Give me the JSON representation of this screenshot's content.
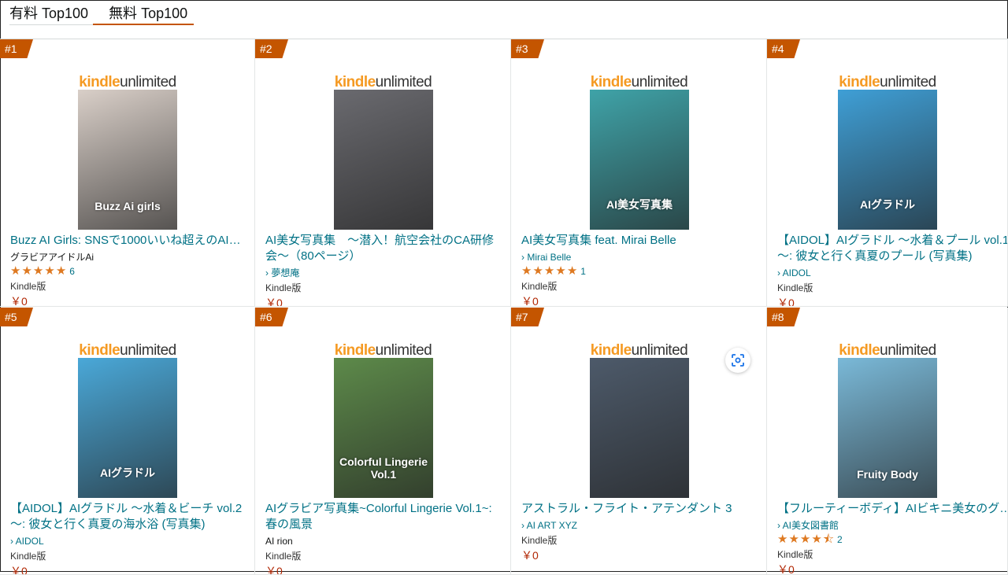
{
  "tabs": {
    "paid": "有料 Top100",
    "free": "無料 Top100"
  },
  "ku_logo": {
    "kindle": "kindle",
    "unlimited": "unlimited"
  },
  "colors": {
    "accent": "#c45500",
    "link": "#007185",
    "price": "#b12704",
    "star": "#de7921"
  },
  "items": [
    {
      "rank": "#1",
      "title": "Buzz AI Girls: SNSで1000いいね超えのAI…",
      "author": "グラビアアイドルAi",
      "author_link": false,
      "rating": 5,
      "count": "6",
      "format": "Kindle版",
      "price": "￥0",
      "cover_text": "Buzz Ai girls",
      "cover_bg": "#d9cfc8"
    },
    {
      "rank": "#2",
      "title": "AI美女写真集　～潜入！航空会社のCA研修会～（80ページ）",
      "author": "› 夢想庵",
      "author_link": true,
      "format": "Kindle版",
      "price": "￥0",
      "cover_text": "",
      "cover_bg": "#6a6a6f"
    },
    {
      "rank": "#3",
      "title": "AI美女写真集 feat. Mirai Belle",
      "author": "› Mirai Belle",
      "author_link": true,
      "rating": 5,
      "count": "1",
      "format": "Kindle版",
      "price": "￥0",
      "cover_text": "AI美女写真集",
      "cover_bg": "#3fa3a8"
    },
    {
      "rank": "#4",
      "title": "【AIDOL】AIグラドル ～水着＆プール vol.1～: 彼女と行く真夏のプール (写真集)",
      "author": "› AIDOL",
      "author_link": true,
      "format": "Kindle版",
      "price": "￥0",
      "cover_text": "AIグラドル",
      "cover_bg": "#3f9fd6"
    },
    {
      "rank": "#5",
      "title": "【AIDOL】AIグラドル ～水着＆ビーチ vol.2～: 彼女と行く真夏の海水浴 (写真集)",
      "author": "› AIDOL",
      "author_link": true,
      "format": "Kindle版",
      "price": "￥0",
      "cover_text": "AIグラドル",
      "cover_bg": "#4aa8d8"
    },
    {
      "rank": "#6",
      "title": "AIグラビア写真集~Colorful Lingerie Vol.1~: 春の風景",
      "author": "AI rion",
      "author_link": false,
      "format": "Kindle版",
      "price": "￥0",
      "cover_text": "Colorful Lingerie Vol.1",
      "cover_bg": "#5d8a4a"
    },
    {
      "rank": "#7",
      "title": "アストラル・フライト・アテンダント 3",
      "author": "› AI ART XYZ",
      "author_link": true,
      "format": "Kindle版",
      "price": "￥0",
      "cover_text": "",
      "cover_bg": "#4d5a6a"
    },
    {
      "rank": "#8",
      "title": "【フルーティーボディ】AIビキニ美女のグラ…",
      "author": "› AI美女図書館",
      "author_link": true,
      "rating": 4.5,
      "count": "2",
      "format": "Kindle版",
      "price": "￥0",
      "cover_text": "Fruity Body",
      "cover_bg": "#7ab9d8"
    }
  ]
}
